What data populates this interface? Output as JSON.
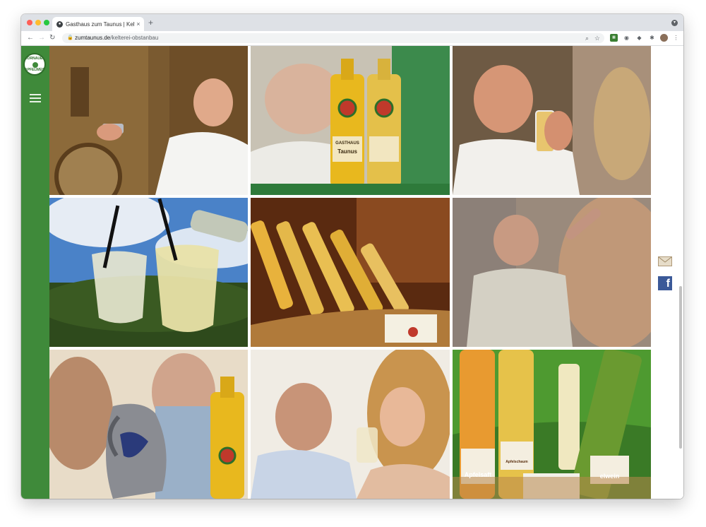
{
  "browser": {
    "tab": {
      "title": "Gasthaus zum Taunus | Kelterei",
      "close": "×"
    },
    "new_tab": "+",
    "nav": {
      "back": "←",
      "forward": "→",
      "reload": "↻"
    },
    "url": {
      "host": "zumtaunus.de",
      "path": "/kelterei-obstanbau"
    },
    "icons": [
      "zoom-icon",
      "star-icon",
      "extension-icons",
      "puzzle-icon",
      "profile-avatar",
      "kebab-menu-icon"
    ]
  },
  "sidebar": {
    "logo": {
      "top": "HORNAUER",
      "bottom": "APFELWEIN"
    },
    "menu_icon": "hamburger-icon",
    "color": "#3f8a3a"
  },
  "gallery": {
    "labels": {
      "bottle_brand": "GASTHAUS",
      "bottle_name": "Taunus",
      "crate_left": "Apfelsaft",
      "crate_right": "elwein",
      "crate_mid": "Apfelschaum"
    }
  },
  "social": {
    "mail_icon": "envelope-icon",
    "facebook": "f"
  }
}
